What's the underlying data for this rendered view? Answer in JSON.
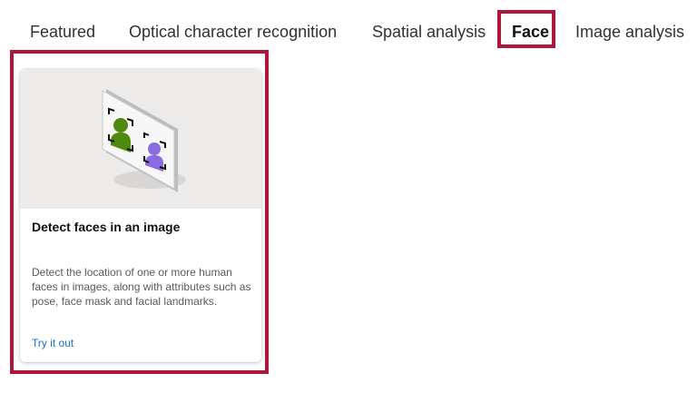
{
  "tabs": [
    {
      "label": "Featured",
      "selected": false
    },
    {
      "label": "Optical character recognition",
      "selected": false
    },
    {
      "label": "Spatial analysis",
      "selected": false
    },
    {
      "label": "Face",
      "selected": true
    },
    {
      "label": "Image analysis",
      "selected": false
    }
  ],
  "card": {
    "illustration_icon": "face-detection-illustration",
    "title": "Detect faces in an image",
    "description": "Detect the location of one or more human faces in images, along with attributes such as pose, face mask and facial landmarks.",
    "link_label": "Try it out"
  },
  "colors": {
    "highlight": "#b0153a",
    "link": "#1a6fc4",
    "face_green": "#4f8a10",
    "face_purple": "#8a6be0"
  }
}
